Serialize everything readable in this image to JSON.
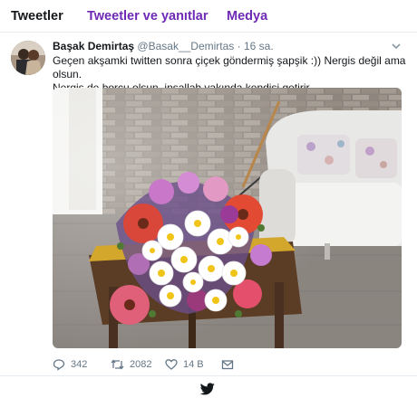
{
  "tabs": [
    {
      "label": "Tweetler"
    },
    {
      "label": "Tweetler ve yanıtlar"
    },
    {
      "label": "Medya"
    }
  ],
  "tweet": {
    "name": "Başak Demirtaş",
    "handle": "@Basak__Demirtas",
    "separator": "·",
    "time": "16 sa.",
    "text_line1": "Geçen akşamki twitten sonra çiçek göndermiş şapşik :)) Nergis değil ama olsun.",
    "text_line2": "Nergis de borcu olsun, inşallah yakında kendisi getirir."
  },
  "actions": {
    "replies": "342",
    "retweets": "2082",
    "likes": "14 B"
  },
  "colors": {
    "tab_link": "#6e29b5",
    "muted": "#657786",
    "background": "#e6ecf0"
  },
  "icons": [
    "chevron-down-icon",
    "reply-icon",
    "retweet-icon",
    "like-icon",
    "message-icon",
    "twitter-bird-icon"
  ]
}
